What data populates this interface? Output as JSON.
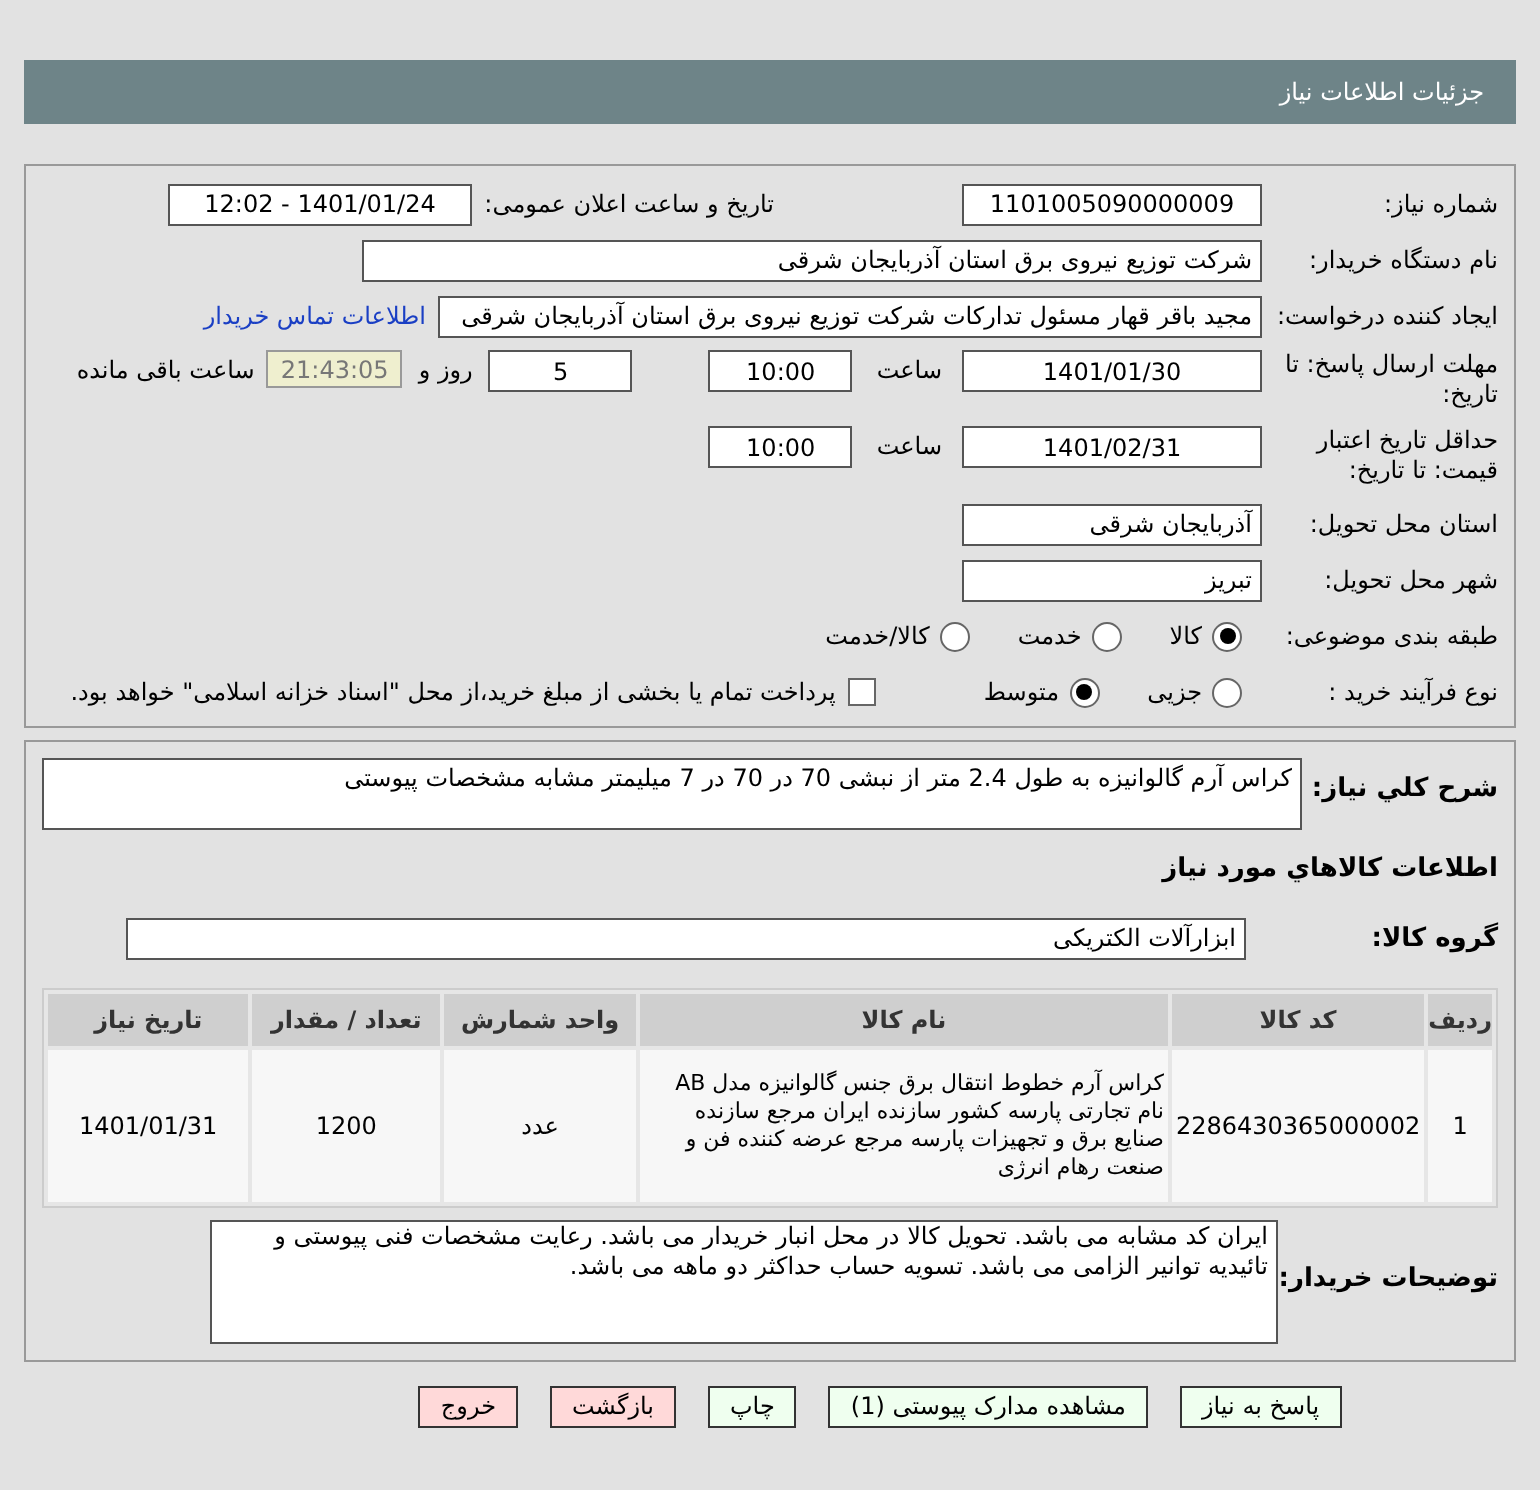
{
  "header": {
    "title": "جزئیات اطلاعات نیاز"
  },
  "need_number": {
    "label": "شماره نیاز:",
    "value": "1101005090000009"
  },
  "announce": {
    "label": "تاریخ و ساعت اعلان عمومی:",
    "value": "1401/01/24 - 12:02"
  },
  "buyer": {
    "label": "نام دستگاه خریدار:",
    "value": "شرکت توزیع نیروی برق استان آذربایجان شرقی"
  },
  "creator": {
    "label": "ایجاد کننده درخواست:",
    "value": "مجید باقر قهار مسئول تدارکات شرکت توزیع نیروی برق استان آذربایجان شرقی",
    "link": "اطلاعات تماس خریدار"
  },
  "deadline": {
    "label": "مهلت ارسال پاسخ: تا تاریخ:",
    "date": "1401/01/30",
    "time_label": "ساعت",
    "time": "10:00",
    "days": "5",
    "days_label": "روز و",
    "remaining": "21:43:05",
    "remaining_label": "ساعت باقی مانده"
  },
  "validity": {
    "label": "حداقل تاریخ اعتبار قیمت: تا تاریخ:",
    "date": "1401/02/31",
    "time_label": "ساعت",
    "time": "10:00"
  },
  "province": {
    "label": "استان محل تحویل:",
    "value": "آذربایجان شرقی"
  },
  "city": {
    "label": "شهر محل تحویل:",
    "value": "تبریز"
  },
  "category": {
    "label": "طبقه بندی موضوعی:",
    "options": [
      {
        "label": "کالا",
        "selected": true
      },
      {
        "label": "خدمت",
        "selected": false
      },
      {
        "label": "کالا/خدمت",
        "selected": false
      }
    ]
  },
  "process": {
    "label": "نوع فرآیند خرید :",
    "options": [
      {
        "label": "جزیی",
        "selected": false
      },
      {
        "label": "متوسط",
        "selected": true
      }
    ],
    "payment": {
      "label": "پرداخت تمام یا بخشی از مبلغ خرید،از محل \"اسناد خزانه اسلامی\" خواهد بود.",
      "checked": false
    }
  },
  "description": {
    "label": "شرح كلي نياز:",
    "value": "کراس آرم گالوانیزه به طول 2.4 متر از نبشی 70 در 70 در 7 میلیمتر مشابه مشخصات پیوستی"
  },
  "goods_heading": "اطلاعات کالاهاي مورد نياز",
  "goods_group": {
    "label": "گروه کالا:",
    "value": "ابزارآلات الکتریکی"
  },
  "table": {
    "columns": [
      "ردیف",
      "کد کالا",
      "نام کالا",
      "واحد شمارش",
      "تعداد / مقدار",
      "تاریخ نیاز"
    ],
    "rows": [
      [
        "1",
        "2286430365000002",
        "کراس آرم خطوط انتقال برق جنس گالوانیزه مدل AB نام تجارتی پارسه کشور سازنده ایران مرجع سازنده صنایع برق و تجهیزات پارسه مرجع عرضه کننده فن و صنعت رهام انرژی",
        "عدد",
        "1200",
        "1401/01/31"
      ]
    ]
  },
  "buyer_notes": {
    "label": "توضیحات خریدار:",
    "value": "ایران کد مشابه می باشد. تحویل کالا در محل انبار خریدار می باشد. رعایت مشخصات فنی پیوستی و تائیدیه توانیر الزامی می باشد. تسویه حساب حداکثر دو ماهه می باشد."
  },
  "buttons": [
    {
      "label": "پاسخ به نیاز",
      "kind": "action"
    },
    {
      "label": "مشاهده مدارک پیوستی (1)",
      "kind": "action"
    },
    {
      "label": "چاپ",
      "kind": "action"
    },
    {
      "label": "بازگشت",
      "kind": "exit"
    },
    {
      "label": "خروج",
      "kind": "exit"
    }
  ]
}
